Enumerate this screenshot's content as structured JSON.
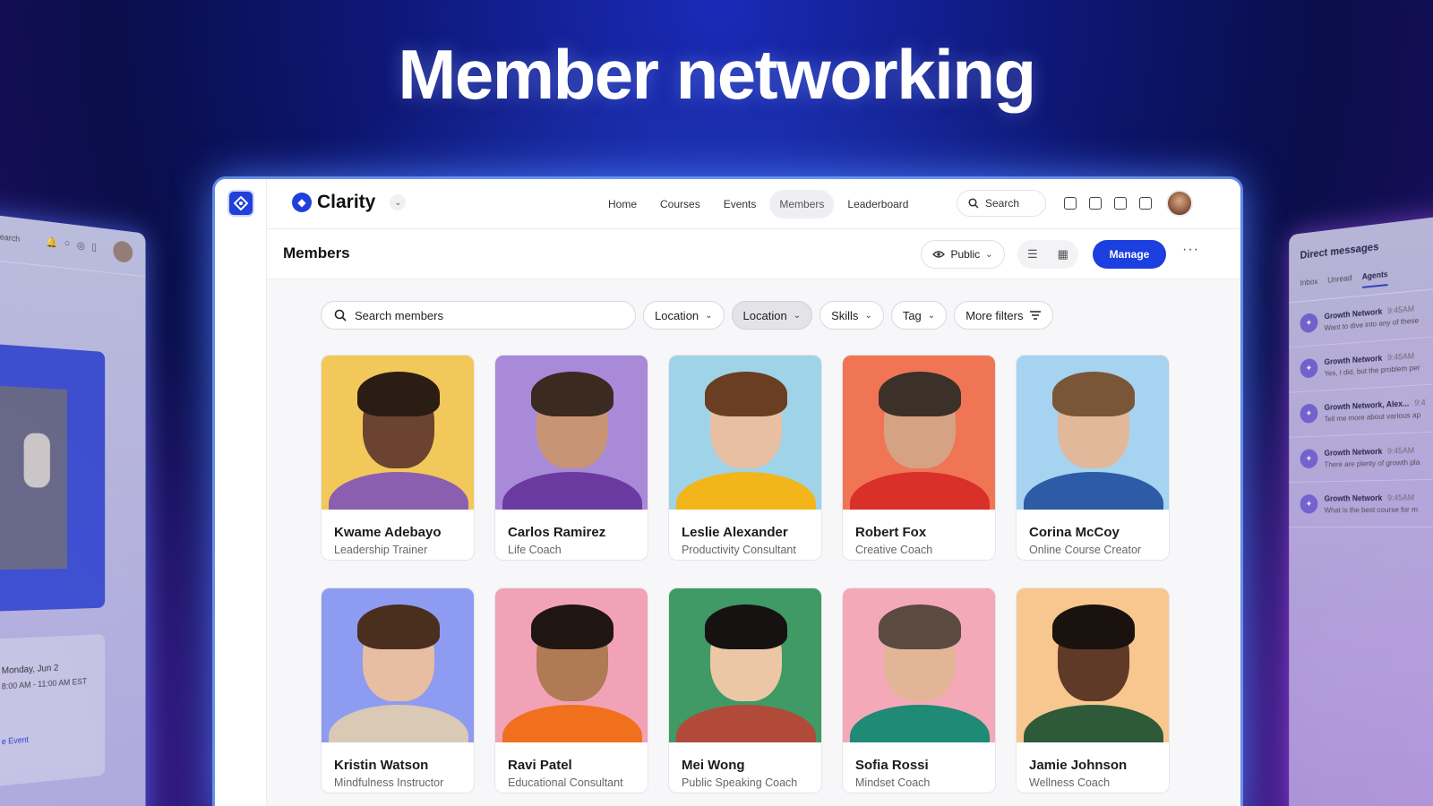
{
  "headline": "Member networking",
  "left_panel": {
    "search_label": "Search",
    "date": "Monday, Jun 2",
    "time": "8:00 AM - 11:00 AM EST",
    "event_link": "e Event"
  },
  "right_panel": {
    "title": "Direct messages",
    "tabs": [
      "Inbox",
      "Unread",
      "Agents"
    ],
    "messages": [
      {
        "name": "Growth Network",
        "time": "9:45AM",
        "text": "Want to dive into any of these"
      },
      {
        "name": "Growth Network",
        "time": "9:45AM",
        "text": "Yes, I did, but the problem per"
      },
      {
        "name": "Growth Network, Alex...",
        "time": "9:4",
        "text": "Tell me more about various ap"
      },
      {
        "name": "Growth Network",
        "time": "9:45AM",
        "text": "There are plenty of growth pla"
      },
      {
        "name": "Growth Network",
        "time": "9:45AM",
        "text": "What is the best course for m"
      }
    ]
  },
  "app": {
    "brand": "Clarity",
    "nav": [
      "Home",
      "Courses",
      "Events",
      "Members",
      "Leaderboard"
    ],
    "active_nav": "Members",
    "search_label": "Search",
    "page_title": "Members",
    "visibility_label": "Public",
    "manage_label": "Manage",
    "more_label": "···",
    "search_placeholder": "Search members",
    "filters": [
      {
        "label": "Location",
        "selected": false
      },
      {
        "label": "Location",
        "selected": true
      },
      {
        "label": "Skills",
        "selected": false
      },
      {
        "label": "Tag",
        "selected": false
      }
    ],
    "more_filters_label": "More filters"
  },
  "members": [
    {
      "name": "Kwame Adebayo",
      "role": "Leadership Trainer",
      "bg": "#f2c85a",
      "skin": "#6b4330",
      "hair": "#2b1c14",
      "shirt": "#8a5fb0"
    },
    {
      "name": "Carlos Ramirez",
      "role": "Life Coach",
      "bg": "#a98ad9",
      "skin": "#c79576",
      "hair": "#3a2a20",
      "shirt": "#6a3aa0"
    },
    {
      "name": "Leslie Alexander",
      "role": "Productivity Consultant",
      "bg": "#9fd3e8",
      "skin": "#e8bfa3",
      "hair": "#6a3e22",
      "shirt": "#f2b51a"
    },
    {
      "name": "Robert Fox",
      "role": "Creative Coach",
      "bg": "#f07555",
      "skin": "#d5a283",
      "hair": "#3c3129",
      "shirt": "#d9302a"
    },
    {
      "name": "Corina McCoy",
      "role": "Online Course Creator",
      "bg": "#a6d3f0",
      "skin": "#e2b89a",
      "hair": "#7a5638",
      "shirt": "#2e5ba5"
    },
    {
      "name": "Kristin Watson",
      "role": "Mindfulness Instructor",
      "bg": "#8d9cf0",
      "skin": "#e7bea1",
      "hair": "#4a2e1e",
      "shirt": "#d9c9b5"
    },
    {
      "name": "Ravi Patel",
      "role": "Educational Consultant",
      "bg": "#f2a2b6",
      "skin": "#b07a55",
      "hair": "#1f1612",
      "shirt": "#f0701e"
    },
    {
      "name": "Mei Wong",
      "role": "Public Speaking Coach",
      "bg": "#3f9a66",
      "skin": "#ebc7a6",
      "hair": "#161212",
      "shirt": "#b24a3a"
    },
    {
      "name": "Sofia Rossi",
      "role": "Mindset Coach",
      "bg": "#f3a9b8",
      "skin": "#e2b596",
      "hair": "#5a4a40",
      "shirt": "#1f8a75"
    },
    {
      "name": "Jamie Johnson",
      "role": "Wellness Coach",
      "bg": "#f7c78f",
      "skin": "#5e3a27",
      "hair": "#1a120e",
      "shirt": "#2f5a3a"
    }
  ]
}
